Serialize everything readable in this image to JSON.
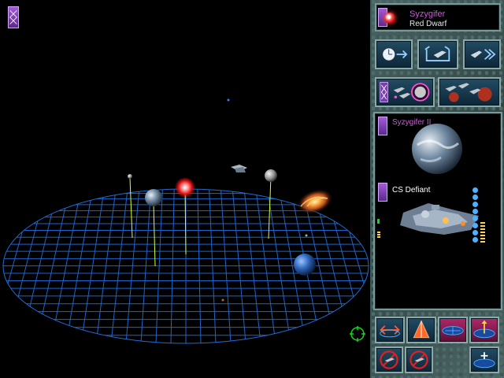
{
  "star": {
    "name": "Syzygifer",
    "type": "Red Dwarf"
  },
  "selection": {
    "planet_label": "Syzygifer II",
    "ship_label": "CS Defiant"
  },
  "icons": {
    "corner": "purple-diamond-tab-icon",
    "time_advance": "clock-arrow-icon",
    "launch": "launch-ship-icon",
    "fleet_move": "fleet-fast-forward-icon",
    "fleet_to_planet": "ships-to-planet-icon",
    "planet_to_ships": "planet-ships-icon",
    "view_rotate": "rotate-view-icon",
    "view_tilt": "tilt-view-icon",
    "grid_toggle": "grid-toggle-icon",
    "grid_select": "grid-select-icon",
    "no_fire": "no-fire-icon",
    "no_target": "no-target-icon",
    "zoom_grid": "zoom-grid-icon"
  },
  "colors": {
    "grid": "#1f6bd6",
    "panel_bg": "#000000",
    "star_name": "#c85cd4",
    "ship_label": "#ffffff"
  }
}
